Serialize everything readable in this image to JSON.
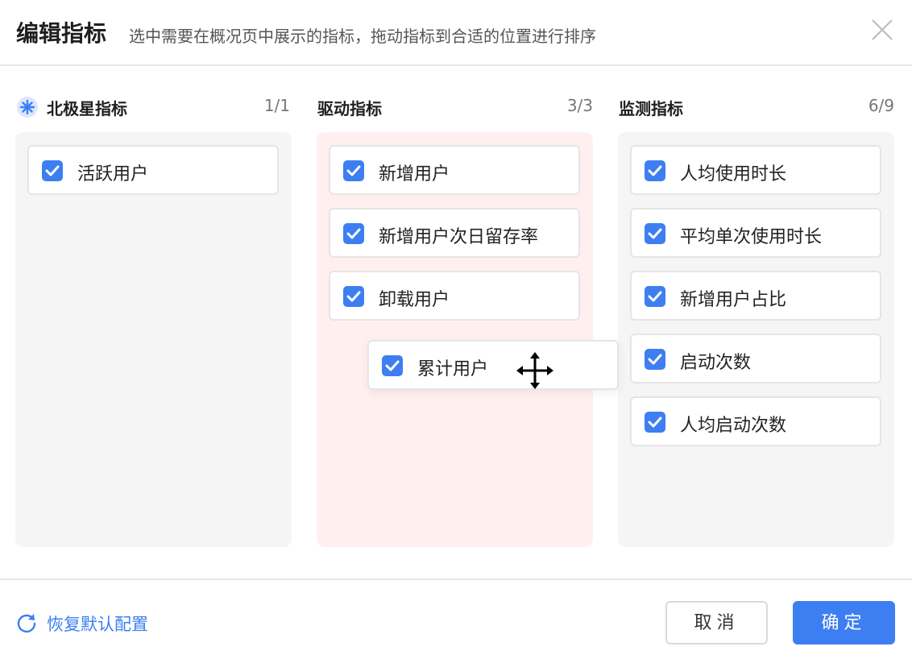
{
  "dialog": {
    "title": "编辑指标",
    "subtitle": "选中需要在概况页中展示的指标，拖动指标到合适的位置进行排序"
  },
  "columns": [
    {
      "title": "北极星指标",
      "count": "1/1",
      "items": [
        "活跃用户"
      ]
    },
    {
      "title": "驱动指标",
      "count": "3/3",
      "items": [
        "新增用户",
        "新增用户次日留存率",
        "卸载用户"
      ]
    },
    {
      "title": "监测指标",
      "count": "6/9",
      "items": [
        "人均使用时长",
        "平均单次使用时长",
        "新增用户占比",
        "启动次数",
        "人均启动次数"
      ]
    }
  ],
  "dragging": {
    "label": "累计用户",
    "checked": true
  },
  "footer": {
    "reset_label": "恢复默认配置",
    "cancel_label": "取消",
    "ok_label": "确定"
  },
  "colors": {
    "accent": "#3d7ff2",
    "drop_zone": "#fff0ef",
    "panel": "#f5f5f5"
  },
  "icons": {
    "north_star": "star-badge-icon",
    "checkbox": "checkbox-checked-icon",
    "close": "close-icon",
    "reset": "refresh-icon",
    "drag_cursor": "move-cursor-icon"
  }
}
